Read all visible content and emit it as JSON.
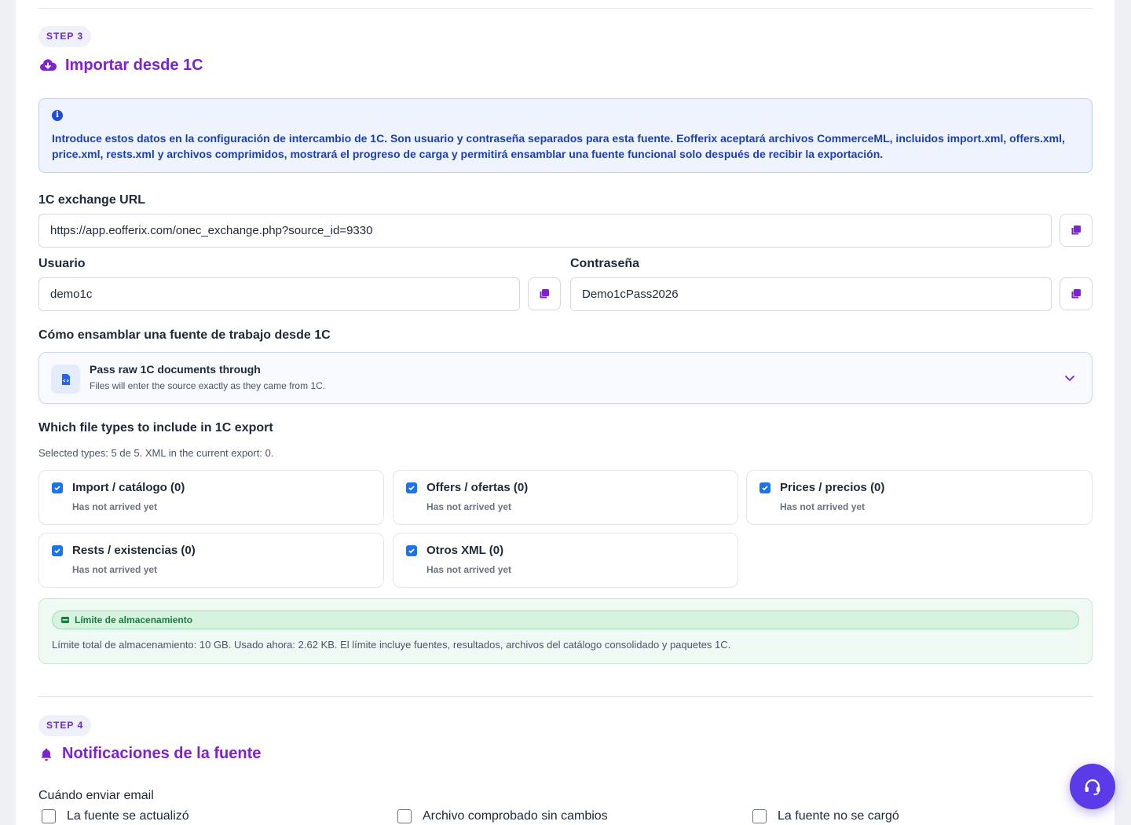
{
  "step3": {
    "badge": "STEP 3",
    "title": "Importar desde 1C",
    "title_icon": "cloud-download-icon",
    "info": "Introduce estos datos en la configuración de intercambio de 1C. Son usuario y contraseña separados para esta fuente. Eofferix aceptará archivos CommerceML, incluidos import.xml, offers.xml, price.xml, rests.xml y archivos comprimidos, mostrará el progreso de carga y permitirá ensamblar una fuente funcional solo después de recibir la exportación.",
    "exchange_url_label": "1C exchange URL",
    "exchange_url": "https://app.eofferix.com/onec_exchange.php?source_id=9330",
    "user_label": "Usuario",
    "user": "demo1c",
    "password_label": "Contraseña",
    "password": "Demo1cPass2026",
    "assemble_label": "Cómo ensamblar una fuente de trabajo desde 1C",
    "assemble_option_title": "Pass raw 1C documents through",
    "assemble_option_sub": "Files will enter the source exactly as they came from 1C.",
    "filetypes_label": "Which file types to include in 1C export",
    "filetypes_summary": "Selected types: 5 de 5. XML in the current export: 0.",
    "filetypes": [
      {
        "title": "Import / catálogo  (0)",
        "status": "Has not arrived yet",
        "checked": true
      },
      {
        "title": "Offers / ofertas  (0)",
        "status": "Has not arrived yet",
        "checked": true
      },
      {
        "title": "Prices / precios  (0)",
        "status": "Has not arrived yet",
        "checked": true
      },
      {
        "title": "Rests / existencias  (0)",
        "status": "Has not arrived yet",
        "checked": true
      },
      {
        "title": "Otros XML  (0)",
        "status": "Has not arrived yet",
        "checked": true
      }
    ],
    "storage_title": "Límite de almacenamiento",
    "storage_text": "Límite total de almacenamiento: 10 GB. Usado ahora: 2.62 KB. El límite incluye fuentes, resultados, archivos del catálogo consolidado y paquetes 1C."
  },
  "step4": {
    "badge": "STEP 4",
    "title": "Notificaciones de la fuente",
    "title_icon": "bell-icon",
    "email_label": "Cuándo enviar email",
    "options": [
      {
        "label": "La fuente se actualizó",
        "checked": false
      },
      {
        "label": "Archivo comprobado sin cambios",
        "checked": false
      },
      {
        "label": "La fuente no se cargó",
        "checked": false
      }
    ]
  },
  "colors": {
    "accent": "#7e22ce",
    "info_bg": "#eef3fd",
    "info_text": "#1e40af",
    "success": "#15803d",
    "help_button": "#5b3be8"
  }
}
